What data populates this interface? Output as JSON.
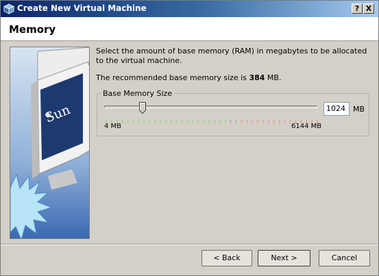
{
  "window": {
    "title": "Create New Virtual Machine",
    "help_glyph": "?",
    "close_glyph": "X"
  },
  "header": {
    "title": "Memory"
  },
  "description": "Select the amount of base memory (RAM) in megabytes to be allocated to the virtual machine.",
  "recommendation": {
    "prefix": "The recommended base memory size is ",
    "value": "384",
    "suffix": " MB."
  },
  "memory": {
    "group_label": "Base Memory Size",
    "value": "1024",
    "unit": "MB",
    "min_label": "4 MB",
    "max_label": "6144 MB",
    "slider_min": 4,
    "slider_max": 6144,
    "slider_value": 1024
  },
  "sidebar_logo_text": "Sun",
  "buttons": {
    "back": "< Back",
    "next": "Next >",
    "cancel": "Cancel"
  },
  "colors": {
    "tick_green": "#7fcf6f",
    "tick_gray": "#9c9a94",
    "tick_red": "#e38a80",
    "accent": "#0a246a"
  }
}
